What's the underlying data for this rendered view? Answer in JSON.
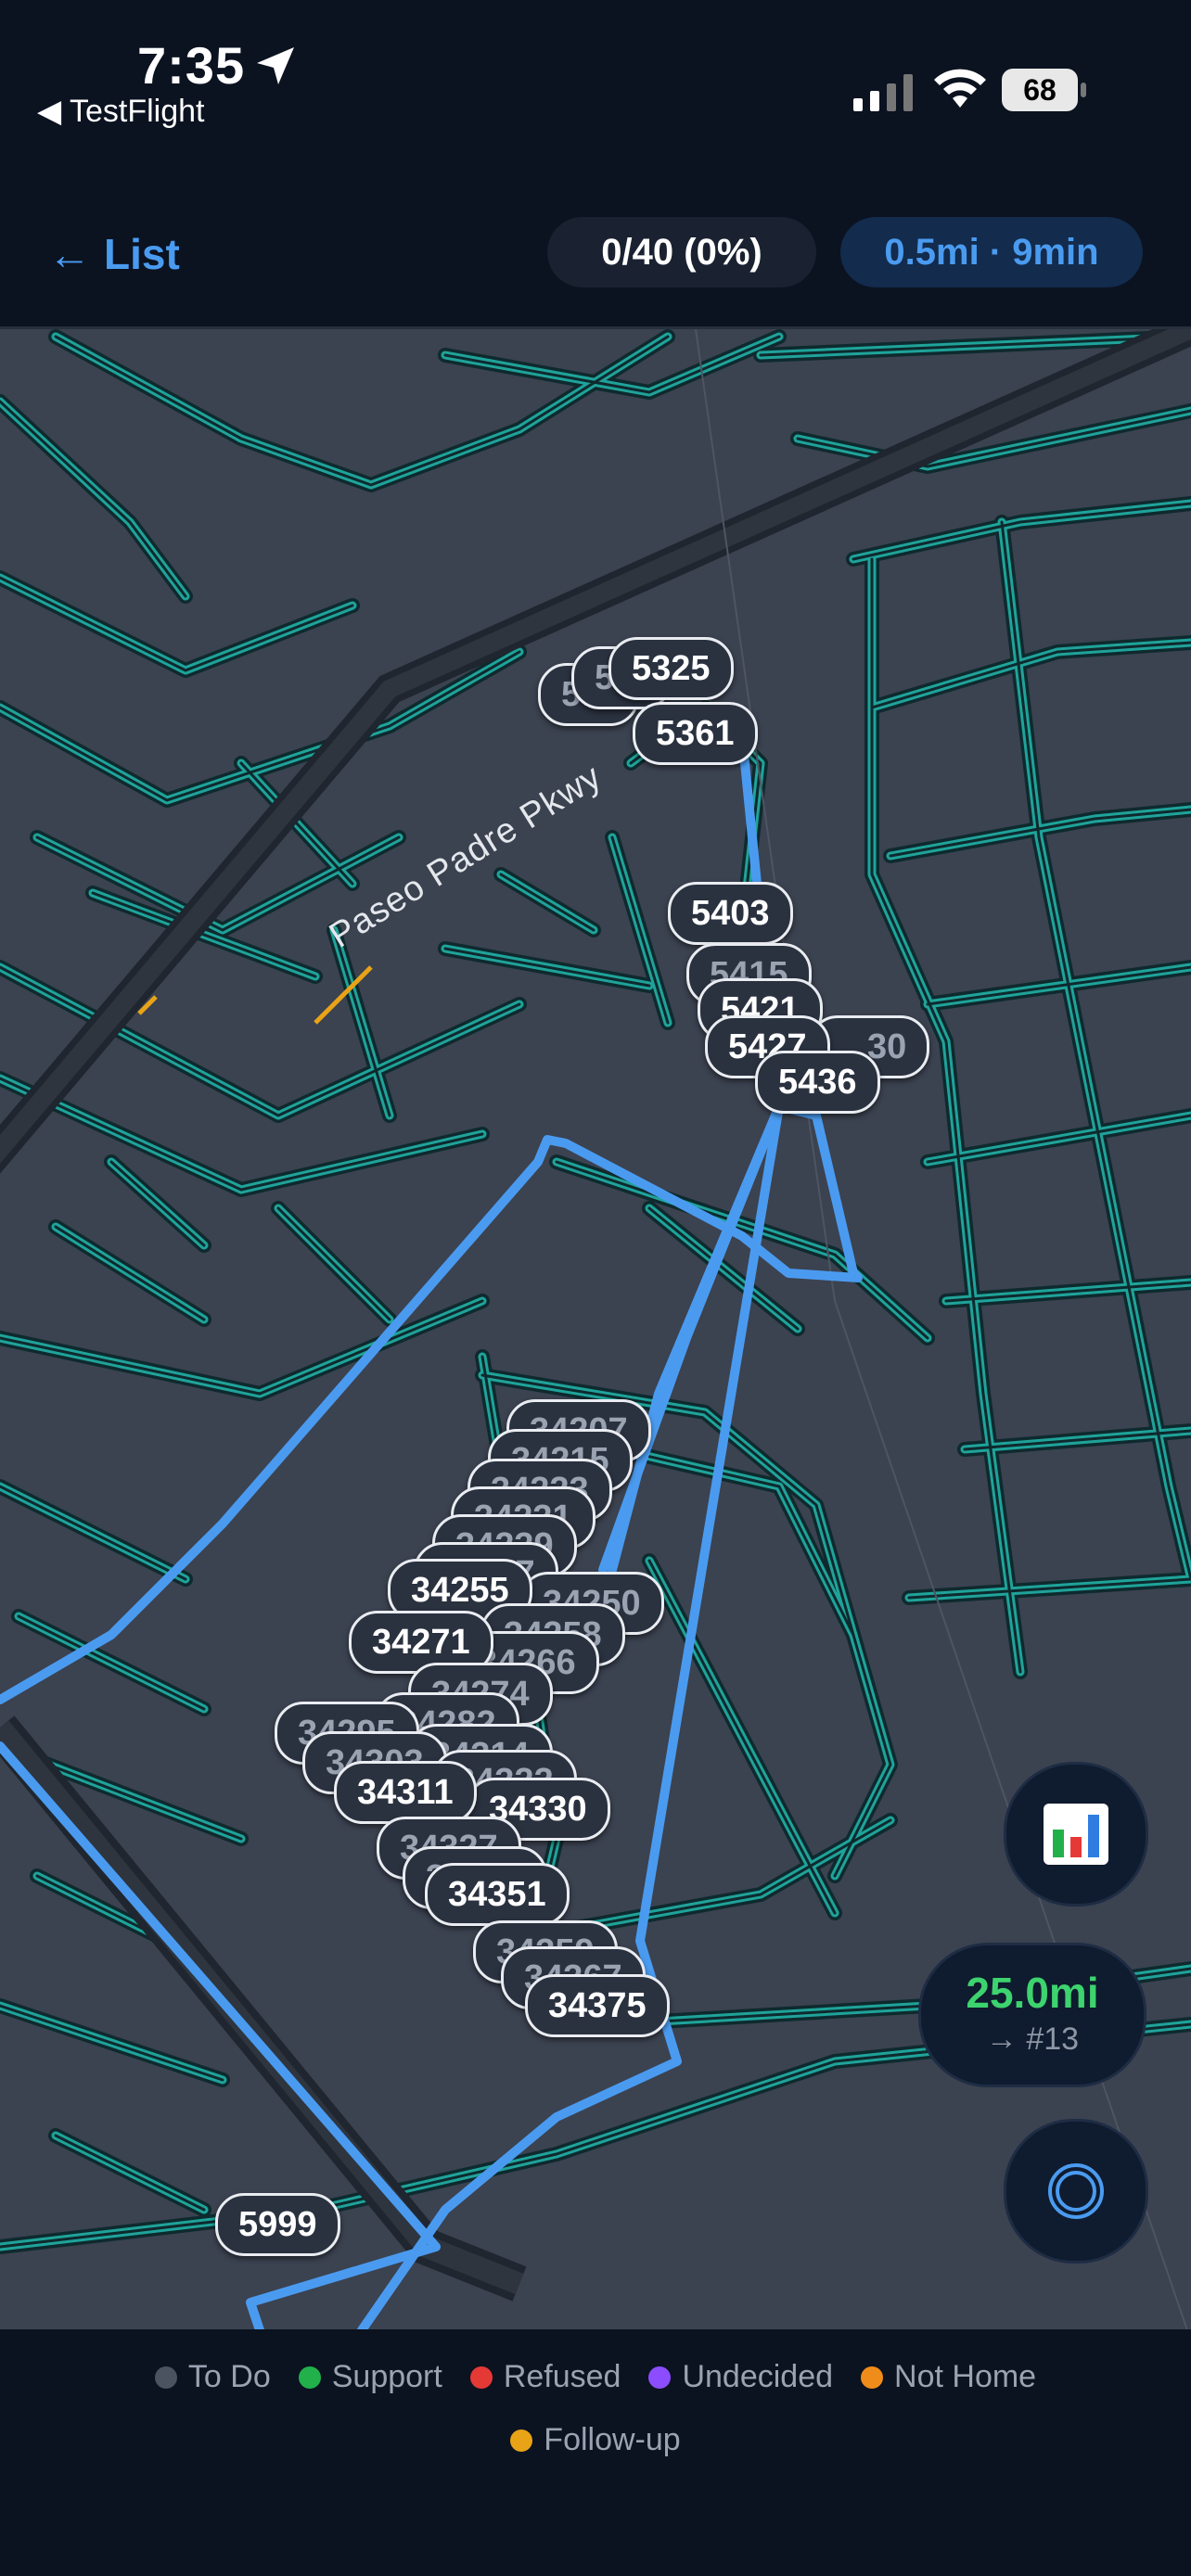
{
  "status": {
    "time": "7:35",
    "back_app": "◀ TestFlight",
    "battery": "68"
  },
  "nav": {
    "back_label": "List",
    "progress": "0/40 (0%)",
    "route_summary": "0.5mi · 9min"
  },
  "map": {
    "street_name": "Paseo Padre Pkwy",
    "markers": {
      "m5325": "5325",
      "m5361": "5361",
      "m5403": "5403",
      "m5415": "5415",
      "m5421": "5421",
      "m5427": "5427",
      "m5436": "5436",
      "m34207": "34207",
      "m34215": "34215",
      "m34223": "34223",
      "m34231": "34231",
      "m34239": "34239",
      "m34247": "34247",
      "m34255": "34255",
      "m34250": "34250",
      "m34258": "34258",
      "m34271": "34271",
      "m34266": "34266",
      "m34274": "34274",
      "m34282": "34282",
      "m34295": "34295",
      "m34314": "34314",
      "m34303": "34303",
      "m34322": "34322",
      "m34311": "34311",
      "m34330": "34330",
      "m34327": "34327",
      "m34338": "34338",
      "m34351": "34351",
      "m34359": "34359",
      "m34367": "34367",
      "m34375": "34375",
      "m5999": "5999"
    }
  },
  "floating": {
    "distance": "25.0mi",
    "next_stop": "→ #13"
  },
  "legend": {
    "items": [
      {
        "label": "To Do",
        "color": "#4b5260"
      },
      {
        "label": "Support",
        "color": "#22b04b"
      },
      {
        "label": "Refused",
        "color": "#e53935"
      },
      {
        "label": "Undecided",
        "color": "#8b4dff"
      },
      {
        "label": "Not Home",
        "color": "#f08c1a"
      },
      {
        "label": "Follow-up",
        "color": "#e8a317"
      }
    ]
  },
  "colors": {
    "accent_blue": "#4a9bf0",
    "street_teal": "#1fa39a",
    "distance_green": "#3dd36e"
  }
}
